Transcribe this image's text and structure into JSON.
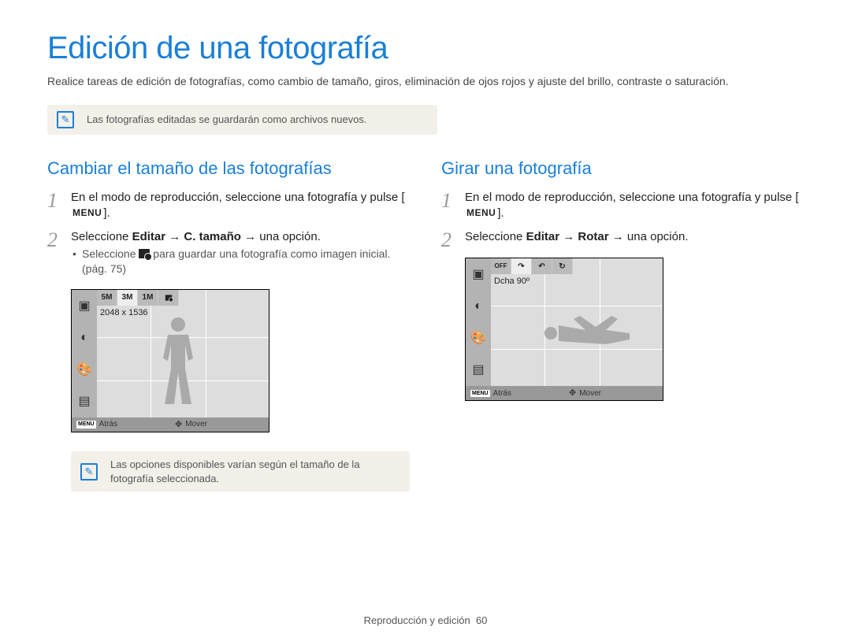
{
  "page": {
    "title": "Edición de una fotografía",
    "intro": "Realice tareas de edición de fotografías, como cambio de tamaño, giros, eliminación de ojos rojos y ajuste del brillo, contraste o saturación.",
    "note1": "Las fotografías editadas se guardarán como archivos nuevos.",
    "footer_section": "Reproducción y edición",
    "footer_page": "60"
  },
  "resize": {
    "heading": "Cambiar el tamaño de las fotografías",
    "step1_a": "En el modo de reproducción, seleccione una fotografía y pulse [",
    "step1_menu": "MENU",
    "step1_b": "].",
    "step2_a": "Seleccione ",
    "step2_b": "Editar",
    "step2_c": " → ",
    "step2_d": "C. tamaño",
    "step2_e": " → una opción.",
    "sub_a": "Seleccione ",
    "sub_b": " para guardar una fotografía como imagen inicial. (pág. 75)",
    "screen": {
      "top_items": [
        "5M",
        "3M",
        "1M",
        ""
      ],
      "label": "2048 x 1536",
      "footer_back": "Atrás",
      "footer_move": "Mover"
    },
    "note2": "Las opciones disponibles varían según el tamaño de la fotografía seleccionada."
  },
  "rotate": {
    "heading": "Girar una fotografía",
    "step1_a": "En el modo de reproducción, seleccione una fotografía y pulse [",
    "step1_menu": "MENU",
    "step1_b": "].",
    "step2_a": "Seleccione ",
    "step2_b": "Editar",
    "step2_c": " → ",
    "step2_d": "Rotar",
    "step2_e": " → una opción.",
    "screen": {
      "label": "Dcha 90º",
      "footer_back": "Atrás",
      "footer_move": "Mover"
    }
  }
}
